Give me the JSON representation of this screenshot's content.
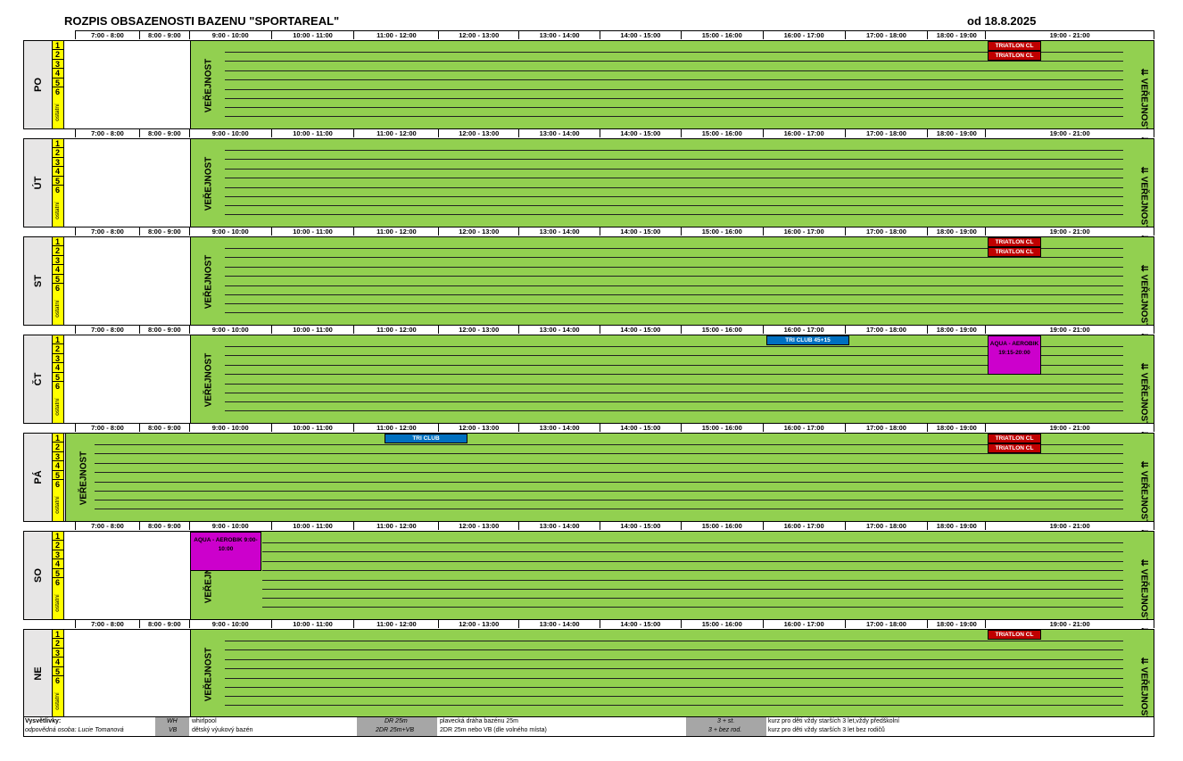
{
  "title": "ROZPIS OBSAZENOSTI BAZENU \"SPORTAREAL\"",
  "valid_from": "od 18.8.2025",
  "time_slots": [
    "7:00 - 8:00",
    "8:00 - 9:00",
    "9:00 - 10:00",
    "10:00 - 11:00",
    "11:00 - 12:00",
    "12:00 - 13:00",
    "13:00 - 14:00",
    "14:00 - 15:00",
    "15:00 - 16:00",
    "16:00 - 17:00",
    "17:00 - 18:00",
    "18:00 - 19:00",
    "19:00 - 21:00"
  ],
  "lanes": [
    "1",
    "2",
    "3",
    "4",
    "5",
    "6"
  ],
  "other_label": "ostatní",
  "public_label": "VEŘEJNOST",
  "public_label_right": "⇊ VEŘEJNOST ⇊",
  "days": [
    {
      "label": "PO",
      "events": [
        "TRIATLON CL",
        "TRIATLON CL"
      ]
    },
    {
      "label": "ÚT",
      "events": []
    },
    {
      "label": "ST",
      "events": [
        "TRIATLON CL",
        "TRIATLON CL"
      ]
    },
    {
      "label": "ČT",
      "events": [
        "TRI CLUB 45+15",
        "AQUA - AEROBIK 19:15-20:00"
      ]
    },
    {
      "label": "PÁ",
      "events": [
        "TRI CLUB",
        "TRIATLON CL",
        "TRIATLON CL"
      ]
    },
    {
      "label": "SO",
      "events": [
        "AQUA - AEROBIK  9:00-10:00"
      ]
    },
    {
      "label": "NE",
      "events": [
        "TRIATLON CL"
      ]
    }
  ],
  "legend": {
    "title": "Vysvětlivky:",
    "responsible": "odpovědná osoba: Lucie Tomanová",
    "items": [
      {
        "code": "WH",
        "desc": "whirlpool"
      },
      {
        "code": "VB",
        "desc": "dětský výukový bazén"
      },
      {
        "code": "DR 25m",
        "desc": "plavecká dráha bazénu 25m"
      },
      {
        "code": "2DR 25m+VB",
        "desc": "2DR 25m nebo VB (dle volného místa)"
      },
      {
        "code": "3 + st.",
        "desc": "kurz pro děti vždy starších 3 let,vždy předškolní"
      },
      {
        "code": "3 + bez rod.",
        "desc": "kurz pro děti vždy starších 3 let bez rodičů"
      }
    ]
  },
  "colors": {
    "public": "#92d050",
    "lane": "#ffff00",
    "triatlon": "#c00000",
    "tri_club": "#0070c0",
    "aqua": "#cc00cc",
    "day_label": "#e7e6e6"
  }
}
